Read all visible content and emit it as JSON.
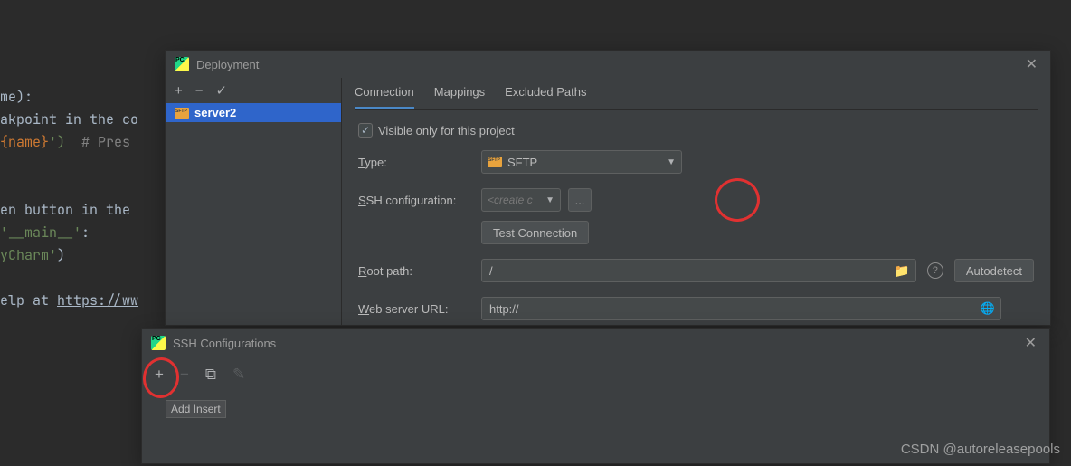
{
  "code": {
    "line1_suffix": "me):",
    "line2": "akpoint in the co",
    "line3_a": "{name}",
    "line3_b": "')  ",
    "line3_c": "# Pres",
    "line5": "en button in the ",
    "line6": "'__main__'",
    "line6_b": ":",
    "line7": "yCharm'",
    "line7_b": ")",
    "line9_a": "elp at ",
    "line9_b": "https://ww"
  },
  "deployment": {
    "title": "Deployment",
    "server_name": "server2",
    "tabs": {
      "connection": "Connection",
      "mappings": "Mappings",
      "excluded": "Excluded Paths"
    },
    "visible_only": "Visible only for this project",
    "type_label_u": "T",
    "type_label": "ype:",
    "type_value": "SFTP",
    "ssh_label_u": "S",
    "ssh_label": "SH configuration:",
    "ssh_placeholder": "<create c",
    "test_connection": "Test Connection",
    "root_label_u": "R",
    "root_label": "oot path:",
    "root_value": "/",
    "autodetect": "Autodetect",
    "web_label_u": "W",
    "web_label": "eb server URL:",
    "web_value": "http://",
    "toolbar": {
      "add": "+",
      "remove": "−",
      "check": "✓"
    }
  },
  "ssh": {
    "title": "SSH Configurations",
    "tooltip": "Add Insert",
    "toolbar": {
      "add": "+",
      "remove": "−",
      "copy": "⧉",
      "edit": "✎"
    }
  },
  "watermark": "CSDN @autoreleasepools"
}
